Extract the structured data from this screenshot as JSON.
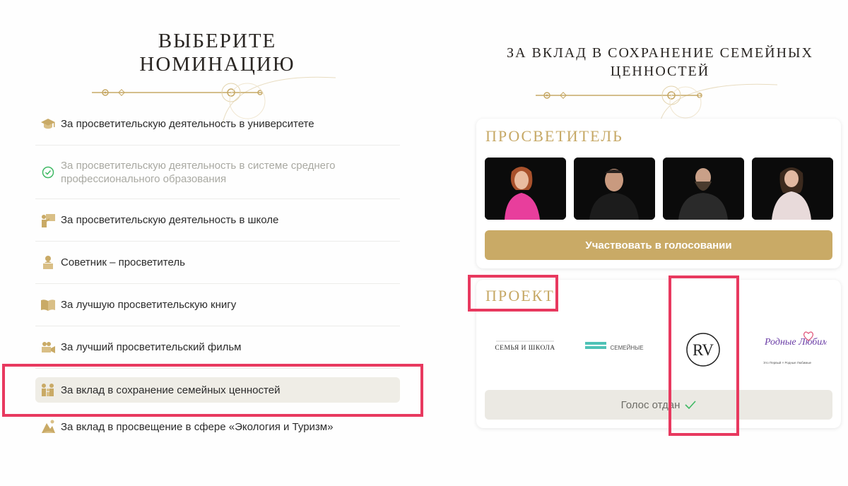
{
  "left": {
    "title": "ВЫБЕРИТЕ НОМИНАЦИЮ",
    "nominations": [
      {
        "label": "За просветительскую деятельность в университете",
        "icon": "graduation-cap-icon",
        "state": "normal"
      },
      {
        "label": "За просветительскую деятельность в системе среднего профессионального образования",
        "icon": "check-circle-icon",
        "state": "voted"
      },
      {
        "label": "За просветительскую деятельность в школе",
        "icon": "teacher-board-icon",
        "state": "normal"
      },
      {
        "label": "Советник – просветитель",
        "icon": "advisor-icon",
        "state": "normal"
      },
      {
        "label": "За лучшую просветительскую книгу",
        "icon": "open-book-icon",
        "state": "normal"
      },
      {
        "label": "За лучший просветительский фильм",
        "icon": "film-camera-icon",
        "state": "normal"
      },
      {
        "label": "За вклад в сохранение семейных ценностей",
        "icon": "family-icon",
        "state": "active"
      },
      {
        "label": "За вклад в просвещение в сфере «Экология и Туризм»",
        "icon": "ecology-tourism-icon",
        "state": "normal"
      }
    ]
  },
  "right": {
    "title": "ЗА ВКЛАД В СОХРАНЕНИЕ СЕМЕЙНЫХ ЦЕННОСТЕЙ",
    "enlightener": {
      "heading": "ПРОСВЕТИТЕЛЬ",
      "vote_label": "Участвовать в голосовании"
    },
    "project": {
      "heading": "ПРОЕКТ",
      "logos": [
        {
          "name": "СЕМЬЯ И ШКОЛА"
        },
        {
          "name": "СЕМЕЙНЫЕ"
        },
        {
          "name": "RV"
        },
        {
          "name": "Родные Любимые",
          "sub": "Это Первый × Родные Любимые"
        }
      ],
      "voted_label": "Голос отдан",
      "voted_icon": "checkmark-icon"
    }
  },
  "colors": {
    "gold": "#c9aa66",
    "heading_gold": "#c6a865",
    "highlight": "#e8395f",
    "active_bg": "#efede6"
  }
}
